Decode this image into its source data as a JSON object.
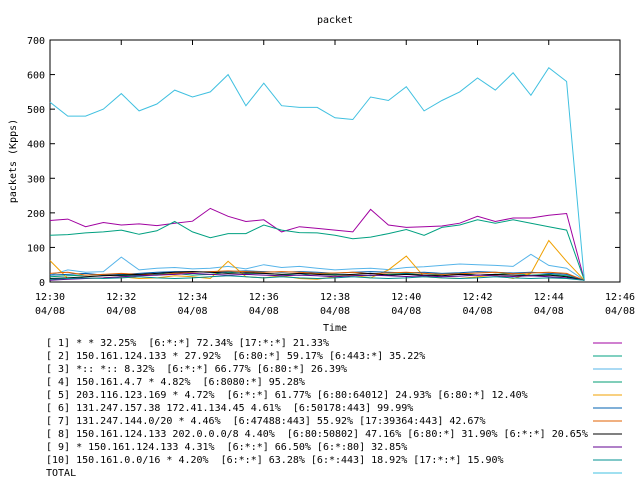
{
  "chart_data": {
    "type": "line",
    "title": "packet",
    "xlabel": "Time",
    "ylabel": "packets (Kpps)",
    "ylim": [
      0,
      700
    ],
    "yticks": [
      0,
      100,
      200,
      300,
      400,
      500,
      600,
      700
    ],
    "xlim": [
      "12:30",
      "12:46"
    ],
    "xticks": [
      {
        "time": "12:30",
        "date": "04/08"
      },
      {
        "time": "12:32",
        "date": "04/08"
      },
      {
        "time": "12:34",
        "date": "04/08"
      },
      {
        "time": "12:36",
        "date": "04/08"
      },
      {
        "time": "12:38",
        "date": "04/08"
      },
      {
        "time": "12:40",
        "date": "04/08"
      },
      {
        "time": "12:42",
        "date": "04/08"
      },
      {
        "time": "12:44",
        "date": "04/08"
      },
      {
        "time": "12:46",
        "date": "04/08"
      }
    ],
    "grid": false,
    "legend_position": "bottom",
    "x": [
      "12:30",
      "12:30:30",
      "12:31",
      "12:31:30",
      "12:32",
      "12:32:30",
      "12:33",
      "12:33:30",
      "12:34",
      "12:34:30",
      "12:35",
      "12:35:30",
      "12:36",
      "12:36:30",
      "12:37",
      "12:37:30",
      "12:38",
      "12:38:30",
      "12:39",
      "12:39:30",
      "12:40",
      "12:40:30",
      "12:41",
      "12:41:30",
      "12:42",
      "12:42:30",
      "12:43",
      "12:43:30",
      "12:44",
      "12:44:30",
      "12:45"
    ],
    "series": [
      {
        "name": "[ 1] * * 32.25%  [6:*:*] 72.34% [17:*:*] 21.33%",
        "color": "#a000a0",
        "values": [
          178,
          182,
          160,
          172,
          165,
          168,
          163,
          170,
          176,
          213,
          190,
          175,
          180,
          145,
          160,
          155,
          150,
          145,
          210,
          165,
          158,
          160,
          162,
          170,
          190,
          175,
          185,
          185,
          193,
          198,
          5
        ]
      },
      {
        "name": "[ 2] 150.161.124.133 * 27.92%  [6:80:*] 59.17% [6:443:*] 35.22%",
        "color": "#00a080",
        "values": [
          135,
          137,
          142,
          145,
          150,
          138,
          148,
          175,
          145,
          128,
          140,
          140,
          165,
          150,
          143,
          142,
          135,
          125,
          130,
          140,
          152,
          135,
          158,
          165,
          180,
          170,
          180,
          170,
          160,
          150,
          5
        ]
      },
      {
        "name": "[ 3] *:: *:: 8.32%  [6:*:*] 66.77% [6:80:*] 26.39%",
        "color": "#56b4e9",
        "values": [
          20,
          35,
          28,
          30,
          72,
          35,
          40,
          42,
          38,
          40,
          45,
          38,
          50,
          42,
          45,
          40,
          35,
          38,
          40,
          36,
          42,
          44,
          48,
          52,
          50,
          48,
          45,
          80,
          48,
          40,
          5
        ]
      },
      {
        "name": "[ 4] 150.161.4.7 * 4.82%  [6:8080:*] 95.28%",
        "color": "#009e73",
        "values": [
          15,
          18,
          20,
          22,
          18,
          20,
          22,
          25,
          20,
          22,
          28,
          25,
          25,
          22,
          20,
          25,
          22,
          20,
          18,
          22,
          25,
          20,
          22,
          25,
          20,
          22,
          25,
          20,
          22,
          18,
          5
        ]
      },
      {
        "name": "[ 5] 203.116.123.169 * 4.72%  [6:*:*] 61.77% [6:80:64012] 24.93% [6:80:*] 12.40%",
        "color": "#f0a000",
        "values": [
          62,
          10,
          10,
          12,
          15,
          10,
          12,
          18,
          15,
          10,
          60,
          15,
          12,
          18,
          10,
          8,
          15,
          20,
          12,
          35,
          75,
          15,
          12,
          10,
          15,
          20,
          10,
          25,
          120,
          60,
          5
        ]
      },
      {
        "name": "[ 6] 131.247.157.38 172.41.134.45 4.61%  [6:50178:443] 99.99%",
        "color": "#0060b0",
        "values": [
          20,
          22,
          25,
          20,
          22,
          25,
          28,
          30,
          30,
          28,
          30,
          32,
          30,
          28,
          30,
          28,
          25,
          28,
          30,
          28,
          26,
          28,
          25,
          27,
          30,
          28,
          26,
          28,
          25,
          22,
          5
        ]
      },
      {
        "name": "[ 7] 131.247.144.0/20 * 4.46%  [6:47488:443] 55.92% [17:39364:443] 42.67%",
        "color": "#e06000",
        "values": [
          25,
          28,
          20,
          22,
          25,
          22,
          20,
          25,
          28,
          30,
          32,
          30,
          28,
          30,
          28,
          25,
          26,
          28,
          24,
          26,
          28,
          25,
          22,
          24,
          26,
          28,
          24,
          26,
          28,
          25,
          5
        ]
      },
      {
        "name": "[ 8] 150.161.124.133 202.0.0.0/8 4.40%  [6:80:50802] 47.16% [6:80:*] 31.90% [6:*:*] 20.65%",
        "color": "#000000",
        "values": [
          10,
          12,
          15,
          18,
          20,
          22,
          25,
          28,
          30,
          28,
          25,
          27,
          25,
          22,
          25,
          22,
          20,
          22,
          25,
          20,
          22,
          20,
          18,
          22,
          20,
          22,
          20,
          18,
          20,
          15,
          5
        ]
      },
      {
        "name": "[ 9] * 150.161.124.133 4.31%  [6:*:*] 66.50% [6:*:80] 32.85%",
        "color": "#600090",
        "values": [
          5,
          8,
          10,
          12,
          15,
          18,
          20,
          22,
          25,
          22,
          20,
          22,
          20,
          18,
          20,
          18,
          15,
          18,
          20,
          18,
          16,
          18,
          15,
          17,
          20,
          18,
          16,
          18,
          15,
          12,
          5
        ]
      },
      {
        "name": "[10] 150.161.0.0/16 * 4.20%  [6:*:*] 63.28% [6:*:443] 18.92% [17:*:*] 15.90%",
        "color": "#009090",
        "values": [
          8,
          10,
          12,
          10,
          12,
          15,
          12,
          10,
          12,
          15,
          18,
          15,
          12,
          15,
          12,
          10,
          12,
          15,
          12,
          10,
          12,
          15,
          12,
          10,
          12,
          15,
          12,
          10,
          12,
          10,
          5
        ]
      },
      {
        "name": "TOTAL",
        "color": "#40c0e0",
        "values": [
          520,
          480,
          480,
          500,
          545,
          495,
          515,
          555,
          535,
          550,
          600,
          510,
          575,
          510,
          505,
          505,
          475,
          470,
          535,
          525,
          565,
          495,
          525,
          550,
          590,
          555,
          605,
          540,
          620,
          580,
          5
        ]
      }
    ]
  }
}
